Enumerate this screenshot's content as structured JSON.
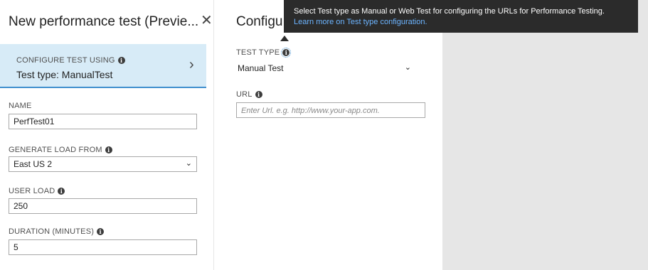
{
  "left_blade": {
    "title": "New performance test (Previe...",
    "close_glyph": "✕",
    "configure": {
      "caption": "CONFIGURE TEST USING",
      "value": "Test type: ManualTest"
    },
    "name": {
      "label": "NAME",
      "value": "PerfTest01"
    },
    "generate_load": {
      "label": "GENERATE LOAD FROM",
      "value": "East US 2"
    },
    "user_load": {
      "label": "USER LOAD",
      "value": "250"
    },
    "duration": {
      "label": "DURATION (MINUTES)",
      "value": "5"
    }
  },
  "middle_blade": {
    "title": "Configu",
    "test_type": {
      "label": "TEST TYPE",
      "value": "Manual Test"
    },
    "url": {
      "label": "URL",
      "placeholder": "Enter Url. e.g. http://www.your-app.com."
    }
  },
  "tooltip": {
    "text": "Select Test type as Manual or Web Test for configuring the URLs for Performance Testing.",
    "link": "Learn more on Test type configuration."
  },
  "icons": {
    "info": "info-icon",
    "close": "close-icon",
    "chevron_right": "chevron-right-icon",
    "chevron_down": "chevron-down-icon"
  },
  "colors": {
    "selected_bg": "#d7ebf7",
    "accent": "#3f8fce",
    "tooltip_bg": "#2b2b2b",
    "link": "#6cb4ff",
    "panel_gray": "#e6e6e6"
  }
}
